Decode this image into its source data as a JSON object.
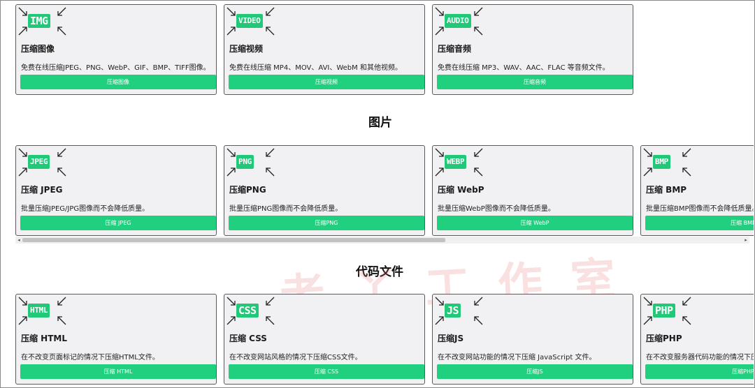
{
  "colors": {
    "accent": "#21d07f",
    "badge": "#21c878",
    "card_bg": "#f1f1f4"
  },
  "rows": [
    {
      "cards": [
        {
          "badge": "IMG",
          "icon": "image-compress-icon",
          "title": "压缩图像",
          "desc": "免费在线压缩JPEG、PNG、WebP、GIF、BMP、TIFF图像。",
          "button": "压缩图像"
        },
        {
          "badge": "VIDEO",
          "icon": "video-compress-icon",
          "title": "压缩视频",
          "desc": "免费在线压缩 MP4、MOV、AVI、WebM 和其他视频。",
          "button": "压缩视频"
        },
        {
          "badge": "AUDIO",
          "icon": "audio-compress-icon",
          "title": "压缩音频",
          "desc": "免费在线压缩 MP3、WAV、AAC、FLAC 等音频文件。",
          "button": "压缩音频"
        }
      ]
    },
    {
      "heading": "图片",
      "cards": [
        {
          "badge": "JPEG",
          "icon": "jpeg-compress-icon",
          "title": "压缩 JPEG",
          "desc": "批量压缩JPEG/JPG图像而不会降低质量。",
          "button": "压缩 JPEG"
        },
        {
          "badge": "PNG",
          "icon": "png-compress-icon",
          "title": "压缩PNG",
          "desc": "批量压缩PNG图像而不会降低质量。",
          "button": "压缩PNG"
        },
        {
          "badge": "WEBP",
          "icon": "webp-compress-icon",
          "title": "压缩 WebP",
          "desc": "批量压缩WebP图像而不会降低质量。",
          "button": "压缩 WebP"
        },
        {
          "badge": "BMP",
          "icon": "bmp-compress-icon",
          "title": "压缩 BMP",
          "desc": "批量压缩BMP图像而不会降低质量。",
          "button": "压缩 BMP"
        }
      ]
    },
    {
      "heading": "代码文件",
      "cards": [
        {
          "badge": "HTML",
          "icon": "html-compress-icon",
          "title": "压缩 HTML",
          "desc": "在不改变页面标记的情况下压缩HTML文件。",
          "button": "压缩 HTML"
        },
        {
          "badge": "CSS",
          "icon": "css-compress-icon",
          "title": "压缩 CSS",
          "desc": "在不改变网站风格的情况下压缩CSS文件。",
          "button": "压缩 CSS"
        },
        {
          "badge": "JS",
          "icon": "js-compress-icon",
          "title": "压缩JS",
          "desc": "在不改变网站功能的情况下压缩 JavaScript 文件。",
          "button": "压缩JS"
        },
        {
          "badge": "PHP",
          "icon": "php-compress-icon",
          "title": "压缩PHP",
          "desc": "在不改变服务器代码功能的情况下压缩PHP文件。",
          "button": "压缩PHP"
        }
      ]
    }
  ],
  "scroll": {
    "left_arrow": "◂",
    "right_arrow": "▸",
    "position_fraction": 0.0
  },
  "watermark": "老丫工作室"
}
